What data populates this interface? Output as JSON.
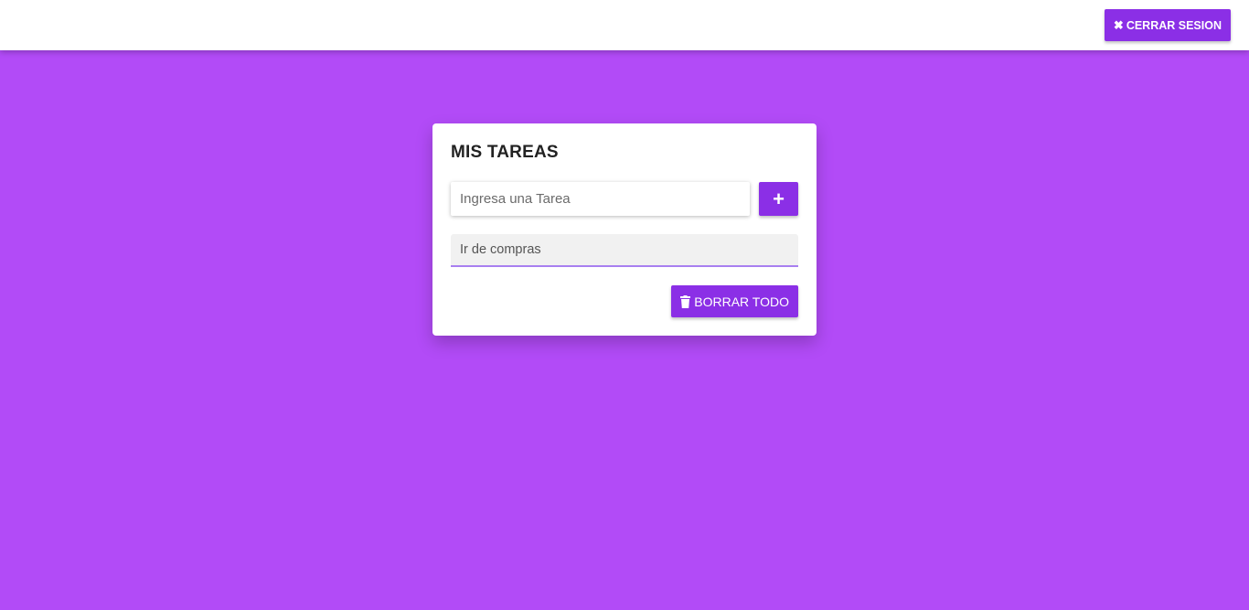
{
  "header": {
    "logout_label": "CERRAR SESION",
    "logout_icon": "close-icon"
  },
  "todo": {
    "title": "MIS TAREAS",
    "input_placeholder": "Ingresa una Tarea",
    "input_value": "",
    "add_icon": "plus-icon",
    "add_label": "+",
    "tasks": [
      {
        "text": "Ir de compras"
      }
    ],
    "clear_label": "BORRAR TODO",
    "clear_icon": "trash-icon"
  },
  "colors": {
    "background": "#b24bf7",
    "accent": "#8b2fe6",
    "task_underline": "#a87ff0",
    "card": "#ffffff"
  }
}
